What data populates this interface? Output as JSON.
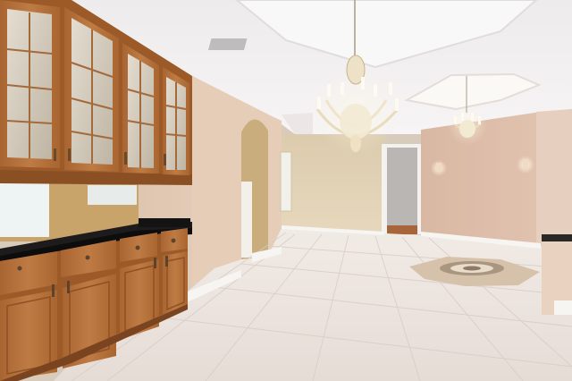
{
  "scene": {
    "description_label": "",
    "palette": {
      "ceiling": "#f3f1f2",
      "ceiling_shadow": "#e6e1e3",
      "wall_warm": "#e2c9b3",
      "wall_far": "#ddc9a8",
      "wall_pink": "#dcb9a6",
      "floor": "#ece4df",
      "floor_grout": "#d9cdc6",
      "cabinet_wood": "#b5713c",
      "cabinet_dark": "#8a4f23",
      "countertop": "#1b1a1a",
      "baseboard": "#f6f4f1",
      "glass": "#d9d3c6",
      "chandelier_gold": "#f2e6c8"
    },
    "objects": {
      "upper_cabinets": "glass-front-upper-cabinets",
      "lower_cabinets": "wood-base-cabinets",
      "countertop": "granite-countertop",
      "chandelier_main": "crystal-chandelier",
      "chandelier_secondary": "crystal-chandelier",
      "tray_ceiling": "tray-ceiling",
      "doorway": "interior-doorway",
      "archway": "arched-opening",
      "floor": "ceramic-tile-floor",
      "medallion": "floor-medallion-inlay",
      "wall_sconces": "wall-sconce"
    }
  }
}
